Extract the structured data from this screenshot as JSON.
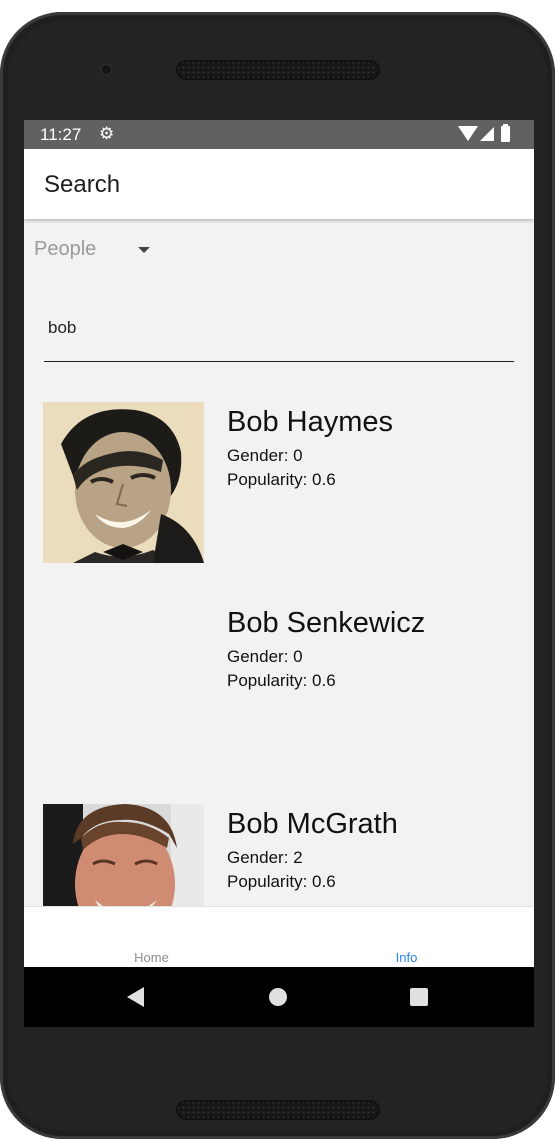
{
  "status_bar": {
    "time": "11:27",
    "icons": [
      "gear-icon",
      "wifi-icon",
      "signal-icon",
      "battery-icon"
    ]
  },
  "app_bar": {
    "title": "Search"
  },
  "search": {
    "category": "People",
    "query": "bob"
  },
  "results": [
    {
      "name": "Bob Haymes",
      "gender": "Gender: 0",
      "popularity": "Popularity: 0.6",
      "has_photo": true
    },
    {
      "name": "Bob Senkewicz",
      "gender": "Gender: 0",
      "popularity": "Popularity: 0.6",
      "has_photo": false
    },
    {
      "name": "Bob McGrath",
      "gender": "Gender: 2",
      "popularity": "Popularity: 0.6",
      "has_photo": true
    }
  ],
  "bottom_nav": {
    "tabs": [
      {
        "label": "Home",
        "active": false
      },
      {
        "label": "Info",
        "active": true
      }
    ]
  },
  "colors": {
    "active_tab": "#2f80ed",
    "inactive_tab": "#8e8e8e",
    "status_bar": "#616161",
    "screen_background": "#f2f2f2"
  }
}
